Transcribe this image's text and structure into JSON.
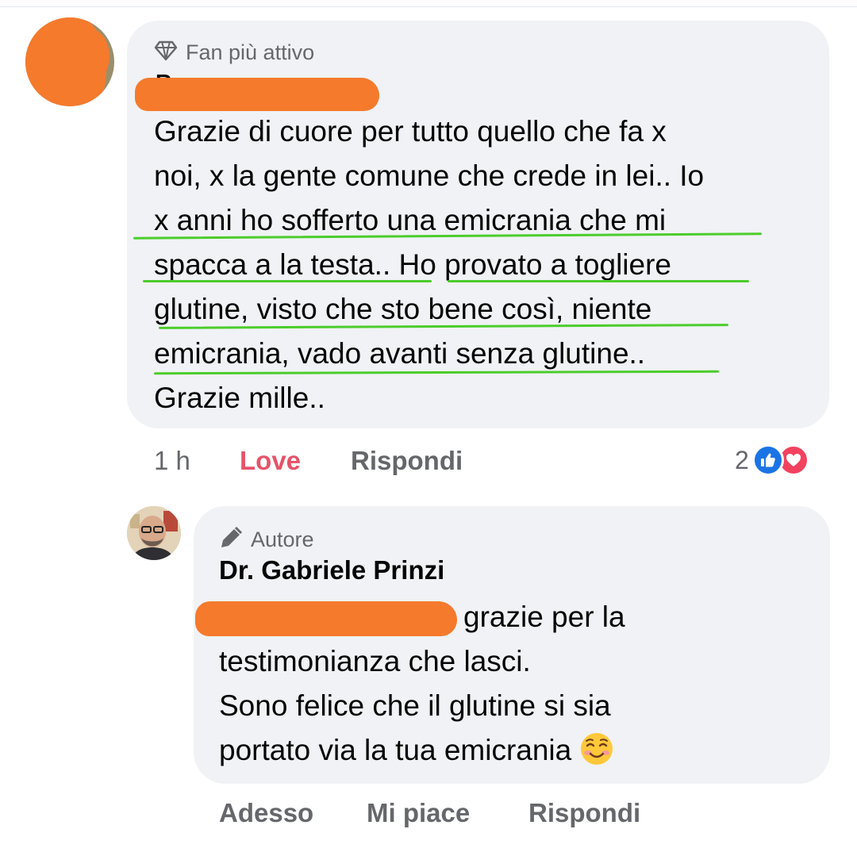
{
  "comment": {
    "badge_label": "Fan più attivo",
    "badge_icon": "diamond-icon",
    "author_peek": "Rc",
    "lines": [
      "Grazie di cuore per tutto quello che fa x",
      "noi, x la gente comune che crede in lei.. Io",
      "x anni ho sofferto una emicrania che mi",
      "spacca a la testa.. Ho provato a togliere",
      "glutine, visto che sto bene così, niente",
      "emicrania, vado avanti senza glutine..",
      "Grazie mille.."
    ],
    "time": "1 h",
    "love_label": "Love",
    "reply_label": "Rispondi",
    "reaction_count": "2",
    "reaction_icons": [
      "like-icon",
      "love-icon"
    ]
  },
  "reply": {
    "badge_label": "Autore",
    "badge_icon": "pencil-icon",
    "author": "Dr. Gabriele Prinzi",
    "lines": [
      "grazie per la",
      "testimonianza che lasci.",
      "Sono felice che il glutine si sia",
      "portato via la tua emicrania"
    ],
    "emoji": "smiling-face-icon",
    "time": "Adesso",
    "like_label": "Mi piace",
    "reply_label": "Rispondi"
  },
  "colors": {
    "bubble": "#f0f2f5",
    "meta_text": "#65676b",
    "love": "#e4546a",
    "redaction": "#f57a2c",
    "underline": "#4ccd2c",
    "like_blue": "#1b74e4",
    "love_red": "#f3425f"
  }
}
